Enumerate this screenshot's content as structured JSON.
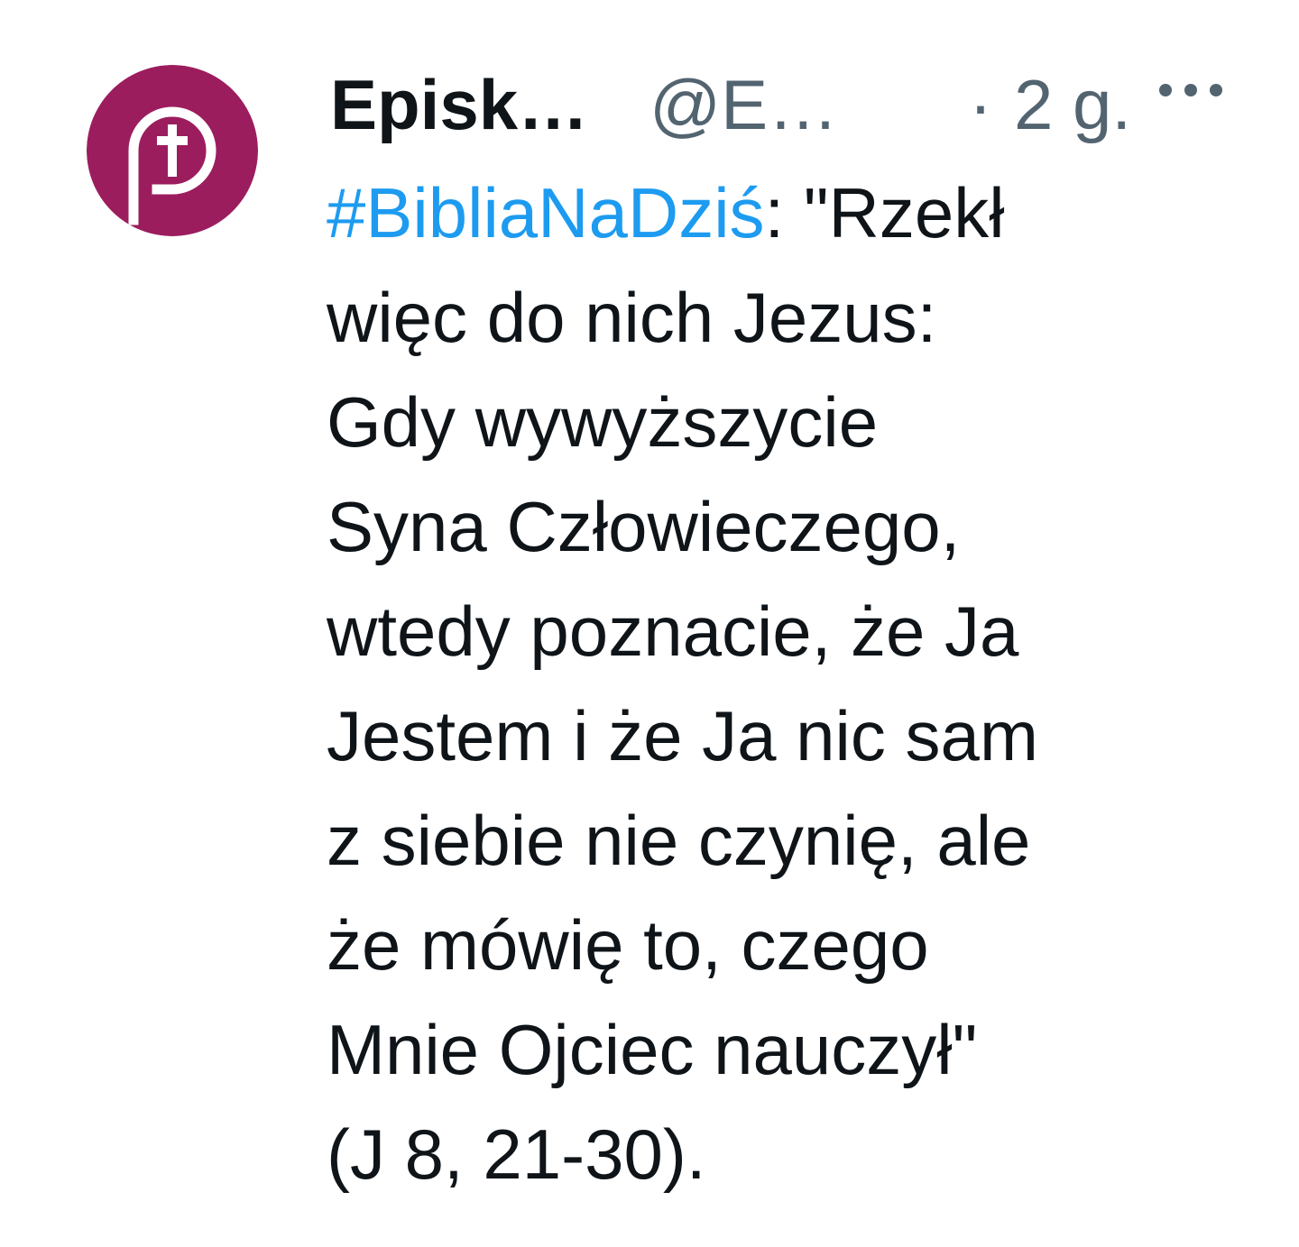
{
  "tweet": {
    "author": {
      "display_name": "Episk…",
      "handle": "@E…",
      "avatar_icon": "episkopat-logo-icon",
      "avatar_color": "#9c1d5e"
    },
    "separator": "·",
    "timestamp": "2 g.",
    "more_icon": "more-options-icon",
    "colors": {
      "text": "#0f1419",
      "secondary": "#536471",
      "hashtag": "#1d9bf0"
    },
    "body": {
      "hashtag": "#BibliaNaDziś",
      "first_line_rest": ": \"Rzekł",
      "lines": [
        "więc do nich Jezus:",
        "Gdy wywyższycie",
        "Syna Człowieczego,",
        "wtedy poznacie, że Ja",
        "Jestem i że Ja nic sam",
        "z siebie nie czynię, ale",
        "że mówię to, czego",
        "Mnie Ojciec nauczył\"",
        "(J 8, 21-30)."
      ]
    }
  }
}
